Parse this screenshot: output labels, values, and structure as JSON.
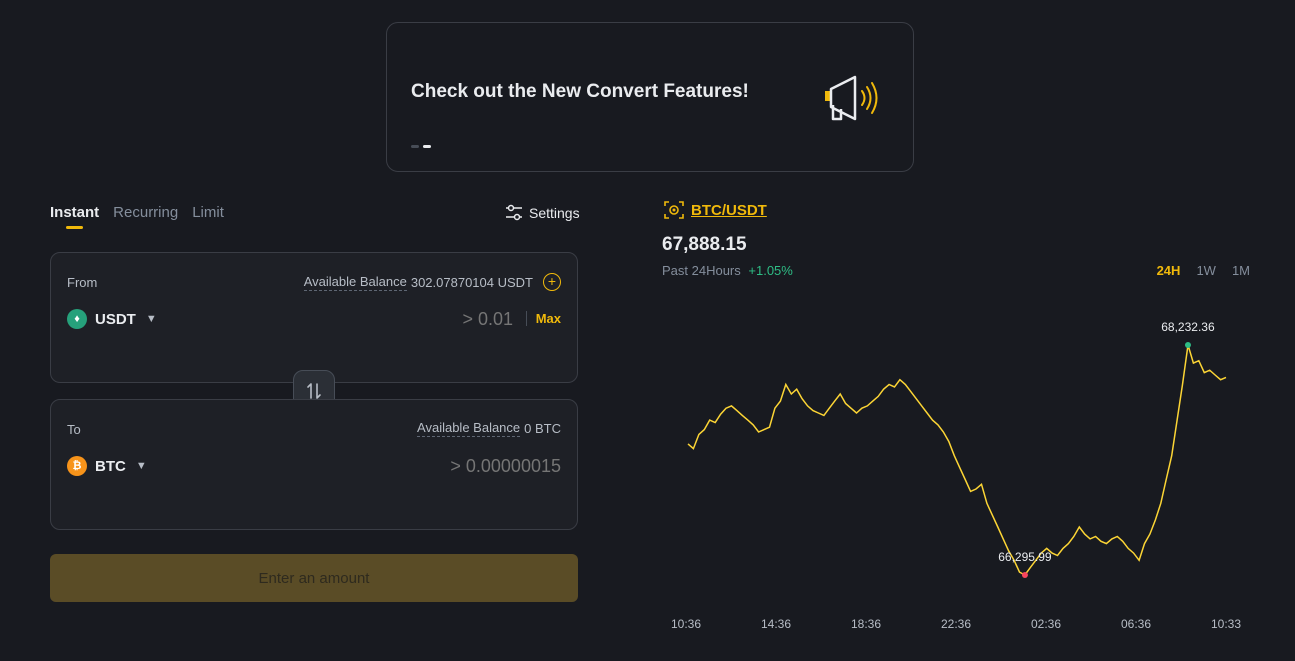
{
  "banner": {
    "title": "Check out the New Convert Features!"
  },
  "tabs": [
    "Instant",
    "Recurring",
    "Limit"
  ],
  "settings_label": "Settings",
  "from": {
    "label": "From",
    "balance_label": "Available Balance",
    "balance_value": "302.07870104 USDT",
    "coin": "USDT",
    "placeholder": "> 0.01",
    "max_label": "Max"
  },
  "to": {
    "label": "To",
    "balance_label": "Available Balance",
    "balance_value": "0 BTC",
    "coin": "BTC",
    "placeholder": "> 0.00000015"
  },
  "submit_label": "Enter an amount",
  "market": {
    "pair": "BTC/USDT",
    "price": "67,888.15",
    "period_label": "Past 24Hours",
    "change": "+1.05%",
    "ranges": [
      "24H",
      "1W",
      "1M"
    ],
    "active_range": "24H"
  },
  "colors": {
    "accent": "#f0b90b",
    "up": "#2ebd85",
    "down": "#f6465d",
    "line": "#fcd535"
  },
  "chart_data": {
    "type": "line",
    "x_ticks": [
      "10:36",
      "14:36",
      "18:36",
      "22:36",
      "02:36",
      "06:36",
      "10:33"
    ],
    "max_label": "68,232.36",
    "min_label": "66,295.99",
    "max": 68232.36,
    "min": 66295.99,
    "values": [
      67400,
      67360,
      67480,
      67520,
      67600,
      67580,
      67650,
      67700,
      67720,
      67680,
      67640,
      67600,
      67560,
      67500,
      67520,
      67540,
      67700,
      67760,
      67900,
      67820,
      67860,
      67780,
      67720,
      67680,
      67660,
      67640,
      67700,
      67760,
      67820,
      67740,
      67700,
      67660,
      67700,
      67720,
      67760,
      67800,
      67860,
      67900,
      67880,
      67940,
      67900,
      67840,
      67780,
      67720,
      67660,
      67600,
      67560,
      67500,
      67420,
      67300,
      67200,
      67100,
      67000,
      67020,
      67060,
      66900,
      66800,
      66700,
      66600,
      66500,
      66420,
      66320,
      66296,
      66360,
      66420,
      66480,
      66520,
      66480,
      66460,
      66520,
      66560,
      66620,
      66700,
      66640,
      66600,
      66620,
      66580,
      66560,
      66600,
      66620,
      66580,
      66520,
      66480,
      66420,
      66560,
      66640,
      66760,
      66900,
      67100,
      67300,
      67600,
      67900,
      68232,
      68080,
      68100,
      68000,
      68020,
      67980,
      67940,
      67960
    ]
  }
}
